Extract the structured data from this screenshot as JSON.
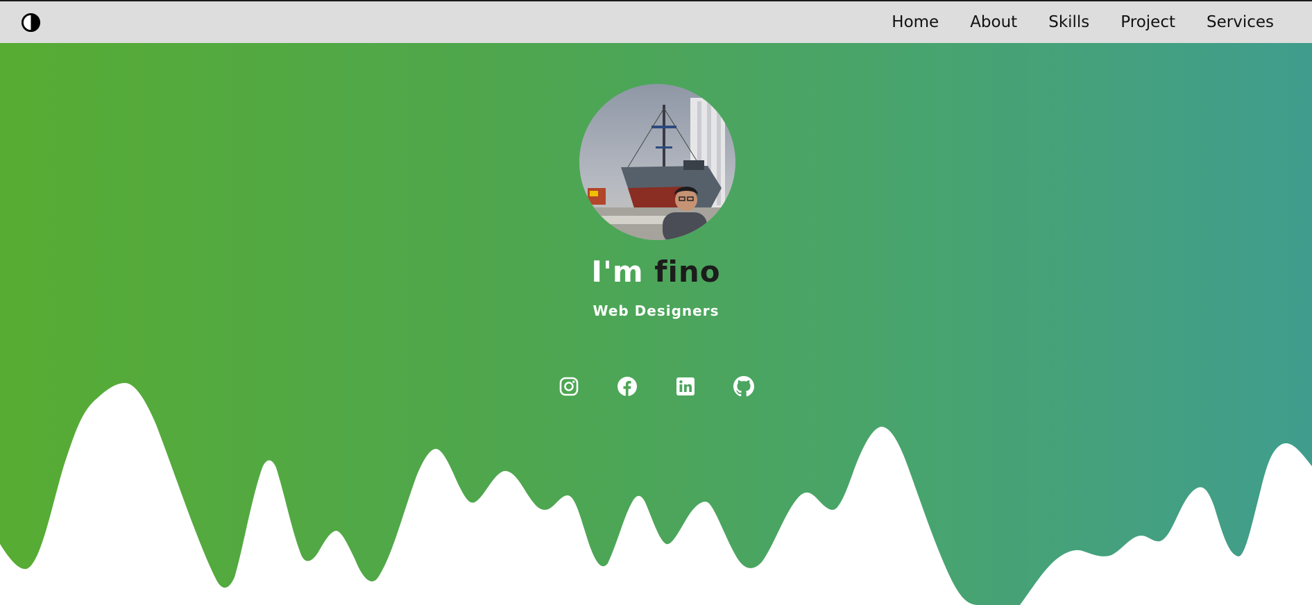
{
  "navbar": {
    "theme_toggle_icon": "half-circle-contrast-icon",
    "links": [
      {
        "label": "Home"
      },
      {
        "label": "About"
      },
      {
        "label": "Skills"
      },
      {
        "label": "Project"
      },
      {
        "label": "Services"
      }
    ]
  },
  "hero": {
    "title_intro": "I'm",
    "title_name": "fino",
    "subtitle": "Web Designers",
    "avatar_icon": "profile-photo",
    "socials": [
      {
        "icon": "instagram-icon"
      },
      {
        "icon": "facebook-icon"
      },
      {
        "icon": "linkedin-icon"
      },
      {
        "icon": "github-icon"
      }
    ],
    "gradient_colors": [
      "#57ac33",
      "#409d8d"
    ]
  }
}
